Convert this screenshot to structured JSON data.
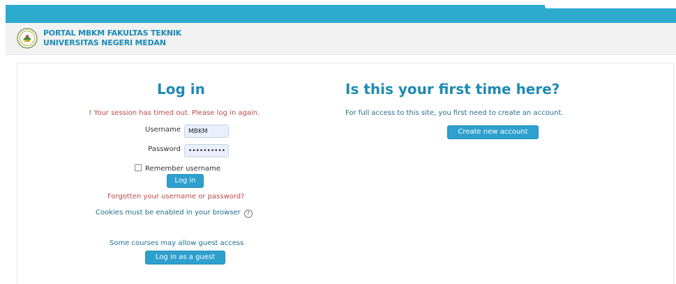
{
  "header": {
    "brand_line1": "PORTAL MBKM FAKULTAS TEKNIK",
    "brand_line2": "UNIVERSITAS NEGERI MEDAN",
    "logo_icon": "university-seal-icon"
  },
  "login": {
    "title": "Log in",
    "timeout_icon": "!",
    "timeout_message": "Your session has timed out. Please log in again.",
    "username_label": "Username",
    "username_value": "MBKM",
    "password_label": "Password",
    "password_value": "••••••••••",
    "remember_label": "Remember username",
    "login_button": "Log in",
    "forgot_link": "Forgotten your username or password?",
    "cookies_note": "Cookies must be enabled in your browser",
    "help_icon": "?",
    "guest_note": "Some courses may allow guest access",
    "guest_button": "Log in as a guest"
  },
  "signup": {
    "title": "Is this your first time here?",
    "description": "For full access to this site, you first need to create an account.",
    "create_button": "Create new account"
  },
  "colors": {
    "accent": "#2eaacf",
    "title": "#1f8ab3",
    "error": "#b94a48"
  }
}
